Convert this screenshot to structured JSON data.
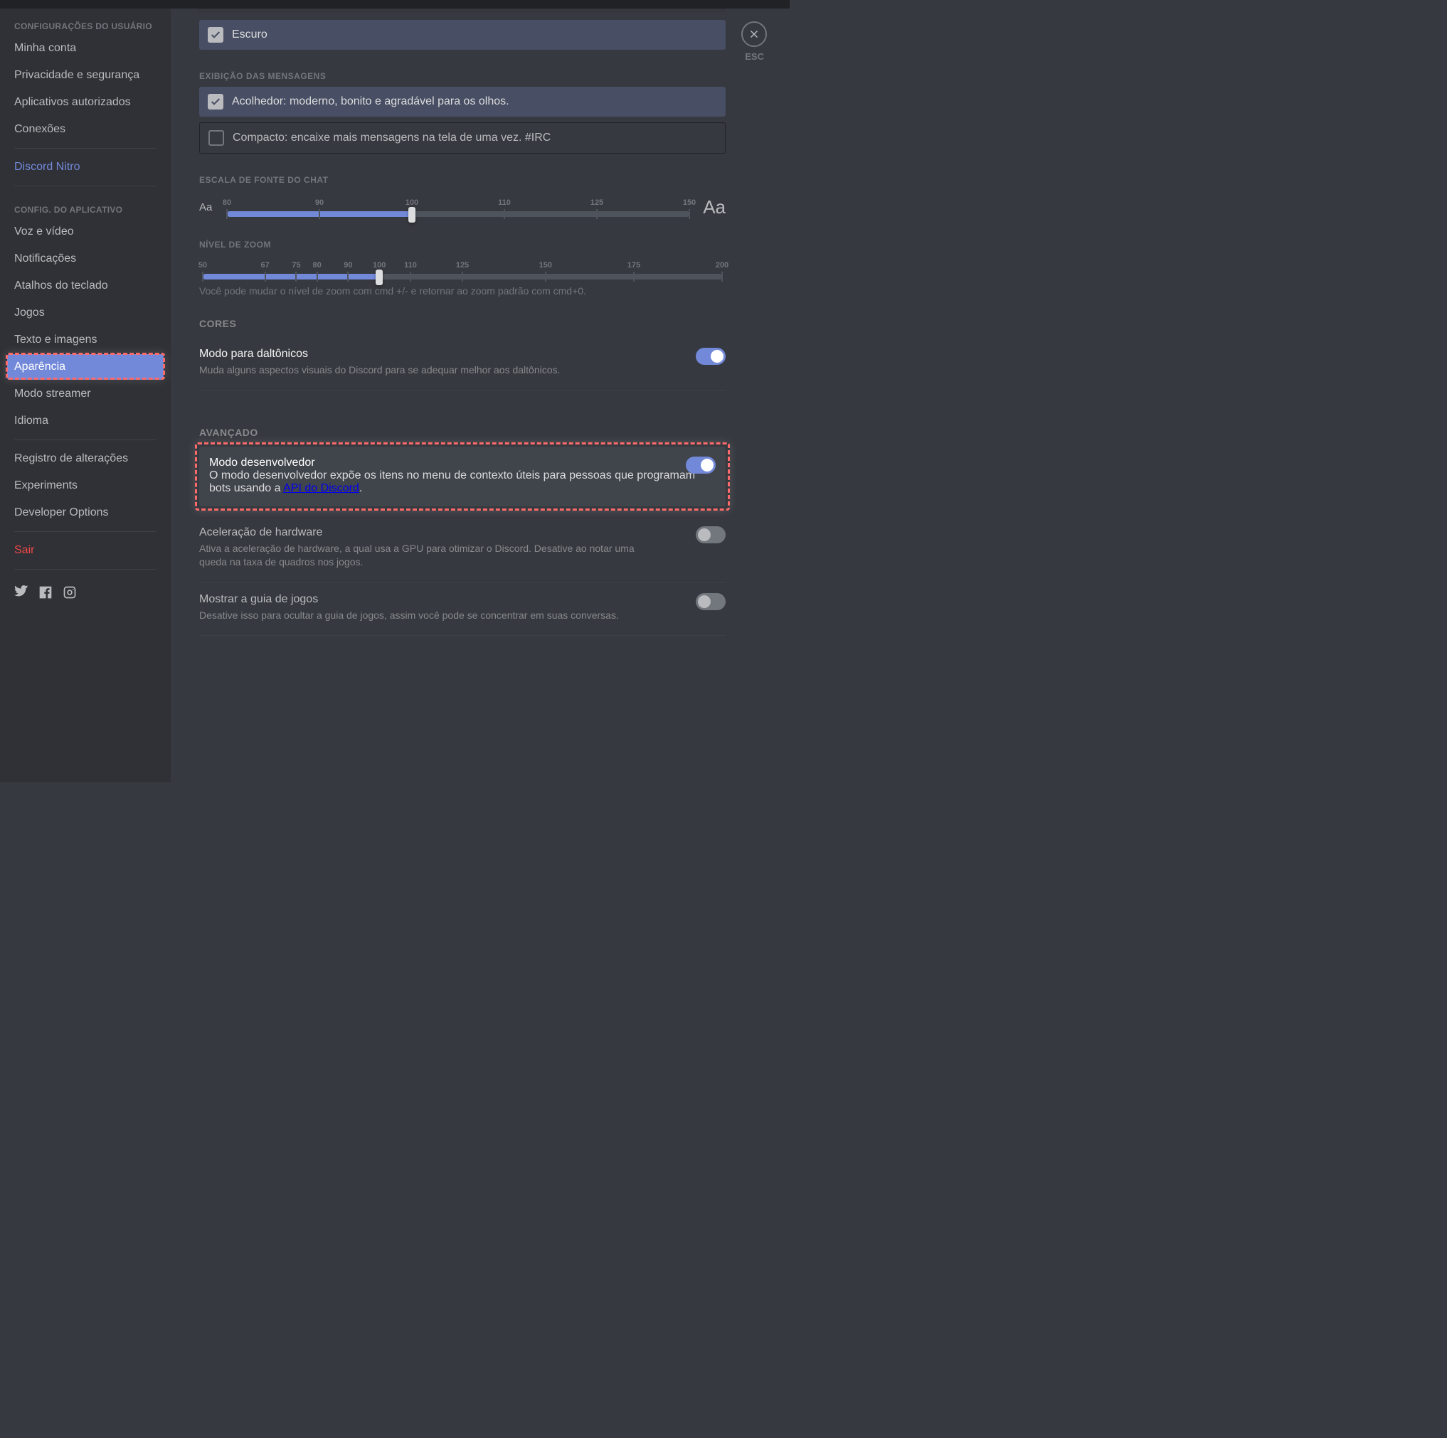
{
  "close_label": "ESC",
  "sidebar": {
    "user_header": "CONFIGURAÇÕES DO USUÁRIO",
    "user_items": [
      "Minha conta",
      "Privacidade e segurança",
      "Aplicativos autorizados",
      "Conexões"
    ],
    "nitro": "Discord Nitro",
    "app_header": "CONFIG. DO APLICATIVO",
    "app_items": [
      "Voz e vídeo",
      "Notificações",
      "Atalhos do teclado",
      "Jogos",
      "Texto e imagens",
      "Aparência",
      "Modo streamer",
      "Idioma"
    ],
    "extra_items": [
      "Registro de alterações",
      "Experiments",
      "Developer Options"
    ],
    "logout": "Sair"
  },
  "appearance": {
    "theme_card": {
      "label": "Escuro"
    },
    "display_header": "EXIBIÇÃO DAS MENSAGENS",
    "cozy": {
      "label": "Acolhedor: moderno, bonito e agradável para os olhos."
    },
    "compact": {
      "label": "Compacto: encaixe mais mensagens na tela de uma vez. #IRC"
    },
    "font_scale": {
      "header": "ESCALA DE FONTE DO CHAT",
      "aa_small": "Aa",
      "aa_big": "Aa",
      "ticks": [
        "80",
        "90",
        "100",
        "110",
        "125",
        "150"
      ],
      "tick_pos": [
        0,
        20,
        40,
        60,
        80,
        100
      ],
      "value_pct": 40
    },
    "zoom": {
      "header": "NÍVEL DE ZOOM",
      "ticks": [
        "50",
        "67",
        "75",
        "80",
        "90",
        "100",
        "110",
        "125",
        "150",
        "175",
        "200"
      ],
      "tick_pos": [
        0,
        12,
        18,
        22,
        28,
        34,
        40,
        50,
        66,
        83,
        100
      ],
      "value_pct": 34,
      "hint": "Você pode mudar o nível de zoom com cmd +/- e retornar ao zoom padrão com cmd+0."
    },
    "colors_header": "CORES",
    "colorblind": {
      "title": "Modo para daltônicos",
      "desc": "Muda alguns aspectos visuais do Discord para se adequar melhor aos daltônicos."
    },
    "advanced_header": "AVANÇADO",
    "dev": {
      "title": "Modo desenvolvedor",
      "desc_pre": "O modo desenvolvedor expõe os itens no menu de contexto úteis para pessoas que programam bots usando a ",
      "link": "API do Discord",
      "desc_post": "."
    },
    "hw": {
      "title": "Aceleração de hardware",
      "desc": "Ativa a aceleração de hardware, a qual usa a GPU para otimizar o Discord. Desative ao notar uma queda na taxa de quadros nos jogos."
    },
    "games_tab": {
      "title": "Mostrar a guia de jogos",
      "desc": "Desative isso para ocultar a guia de jogos, assim você pode se concentrar em suas conversas."
    }
  }
}
